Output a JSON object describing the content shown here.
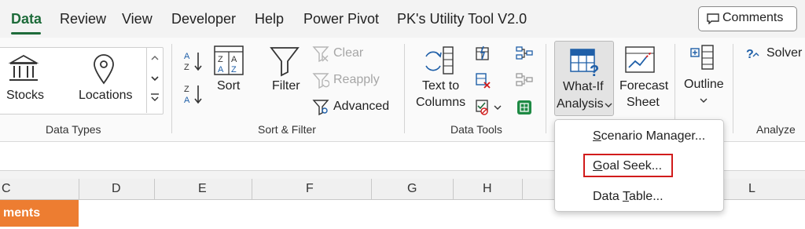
{
  "tabs": [
    "Data",
    "Review",
    "View",
    "Developer",
    "Help",
    "Power Pivot",
    "PK's Utility Tool V2.0"
  ],
  "comments_button": "Comments",
  "groups": {
    "data_types": {
      "label": "Data Types",
      "stocks": "Stocks",
      "locations": "Locations"
    },
    "sort_filter": {
      "label": "Sort & Filter",
      "sort": "Sort",
      "filter": "Filter",
      "clear": "Clear",
      "reapply": "Reapply",
      "advanced": "Advanced"
    },
    "data_tools": {
      "label": "Data Tools",
      "text_to_columns_1": "Text to",
      "text_to_columns_2": "Columns"
    },
    "forecast": {
      "whatif_1": "What-If",
      "whatif_2": "Analysis",
      "forecast_1": "Forecast",
      "forecast_2": "Sheet"
    },
    "outline": {
      "label": "Outline"
    },
    "analyze": {
      "label": "Analyze",
      "solver": "Solver"
    }
  },
  "menu": {
    "scenario_pre": "",
    "scenario_u": "S",
    "scenario_rest": "cenario Manager...",
    "goal_u": "G",
    "goal_rest": "oal Seek...",
    "table_pre": "Data ",
    "table_u": "T",
    "table_rest": "able..."
  },
  "columns": [
    "C",
    "D",
    "E",
    "F",
    "G",
    "H",
    "L"
  ],
  "cell_text": "ments",
  "colors": {
    "accent": "#1e6b3a",
    "highlight": "#d11b1b",
    "orange": "#ed7d31"
  }
}
